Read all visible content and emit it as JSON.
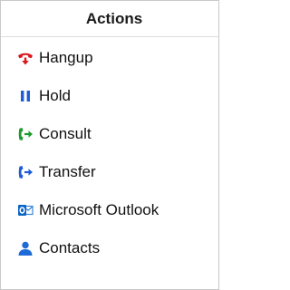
{
  "panel": {
    "title": "Actions"
  },
  "actions": [
    {
      "label": "Hangup",
      "icon": "phone-hangup-icon",
      "color": "#d8161b"
    },
    {
      "label": "Hold",
      "icon": "pause-icon",
      "color": "#1e5bd8"
    },
    {
      "label": "Consult",
      "icon": "consult-icon",
      "color": "#1a9a2a"
    },
    {
      "label": "Transfer",
      "icon": "transfer-icon",
      "color": "#1e5bd8"
    },
    {
      "label": "Microsoft Outlook",
      "icon": "outlook-icon",
      "color": "#0a64c4"
    },
    {
      "label": "Contacts",
      "icon": "contacts-icon",
      "color": "#1e6ad6"
    }
  ]
}
